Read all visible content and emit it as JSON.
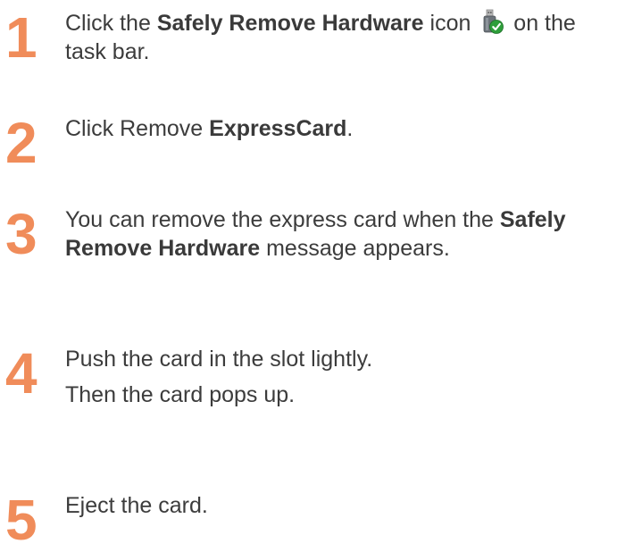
{
  "steps": [
    {
      "number": "1",
      "text_before": "Click the ",
      "bold": "Safely Remove Hardware",
      "text_mid": " icon ",
      "icon": "safely-remove-hardware-icon",
      "text_after": " on the",
      "line2": "task bar."
    },
    {
      "number": "2",
      "text_before": "Click Remove ",
      "bold": "ExpressCard",
      "text_after": "."
    },
    {
      "number": "3",
      "text_before": "You can remove the express card when the ",
      "bold_a": "Safely",
      "bold_b": "Remove Hardware",
      "text_after": " message appears."
    },
    {
      "number": "4",
      "line1": "Push the card in the slot lightly.",
      "line2": "Then the card pops up."
    },
    {
      "number": "5",
      "line1": "Eject the card."
    }
  ],
  "colors": {
    "step_number": "#f08c5a",
    "text": "#3c3c3c",
    "icon_check": "#2e9e3a"
  }
}
